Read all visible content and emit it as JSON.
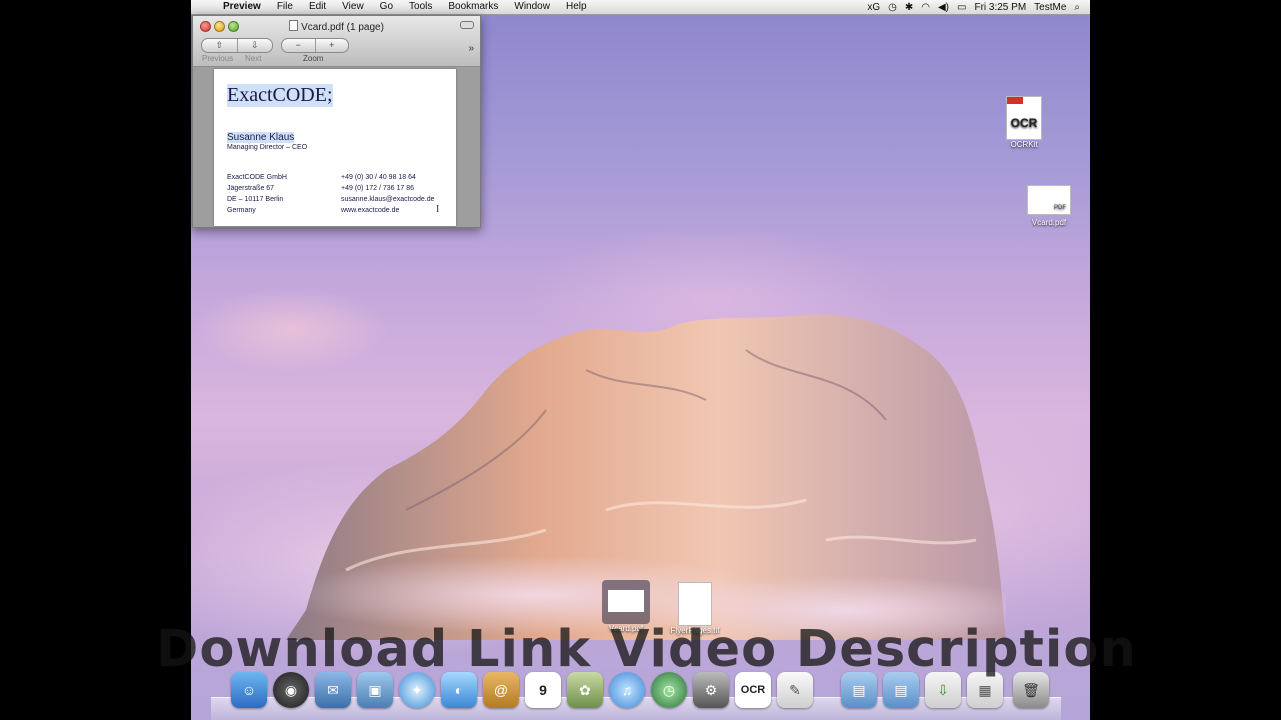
{
  "menubar": {
    "app_name": "Preview",
    "menus": [
      "File",
      "Edit",
      "View",
      "Go",
      "Tools",
      "Bookmarks",
      "Window",
      "Help"
    ],
    "status": {
      "xg": "xG",
      "clock": "Fri 3:25 PM",
      "user": "TestMe"
    }
  },
  "window": {
    "title": "Vcard.pdf (1 page)",
    "toolbar": {
      "previous_label": "Previous",
      "next_label": "Next",
      "zoom_label": "Zoom",
      "zoom_out": "−",
      "zoom_in": "+",
      "more": "»"
    },
    "card": {
      "company": "ExactCODE;",
      "person": "Susanne Klaus",
      "role": "Managing Director – CEO",
      "address": [
        "ExactCODE GmbH",
        "Jägerstraße 67",
        "DE – 10117 Berlin",
        "Germany"
      ],
      "contact": [
        "+49 (0) 30 / 40 98 18 64",
        "+49 (0) 172 / 736 17 86",
        "susanne.klaus@exactcode.de",
        "www.exactcode.de"
      ]
    }
  },
  "desktop": {
    "icons": [
      {
        "label": "OCRKit",
        "badge_text": "OCR"
      },
      {
        "label": "Vcard.pdf",
        "badge_text": "PDF"
      }
    ],
    "drag_items": [
      {
        "label": "Vcard.pdf"
      },
      {
        "label": "FlyerPages.tif"
      }
    ]
  },
  "dock": {
    "items": [
      "Finder",
      "Dashboard",
      "Mail",
      "Preview",
      "Safari",
      "iChat",
      "Address Book",
      "iCal",
      "iPhoto",
      "iTunes",
      "Time Machine",
      "System Preferences",
      "OCRKit",
      "TextEdit",
      "Applications",
      "Documents",
      "Downloads",
      "Pictures",
      "Trash"
    ],
    "ical_day": "9",
    "ocr_text": "OCR"
  },
  "overlay_text": "Download Link Video Description",
  "colors": {
    "close": "#d8352a",
    "minimize": "#d79a12",
    "zoom": "#4da52a",
    "highlight": "#cfe0f7"
  }
}
